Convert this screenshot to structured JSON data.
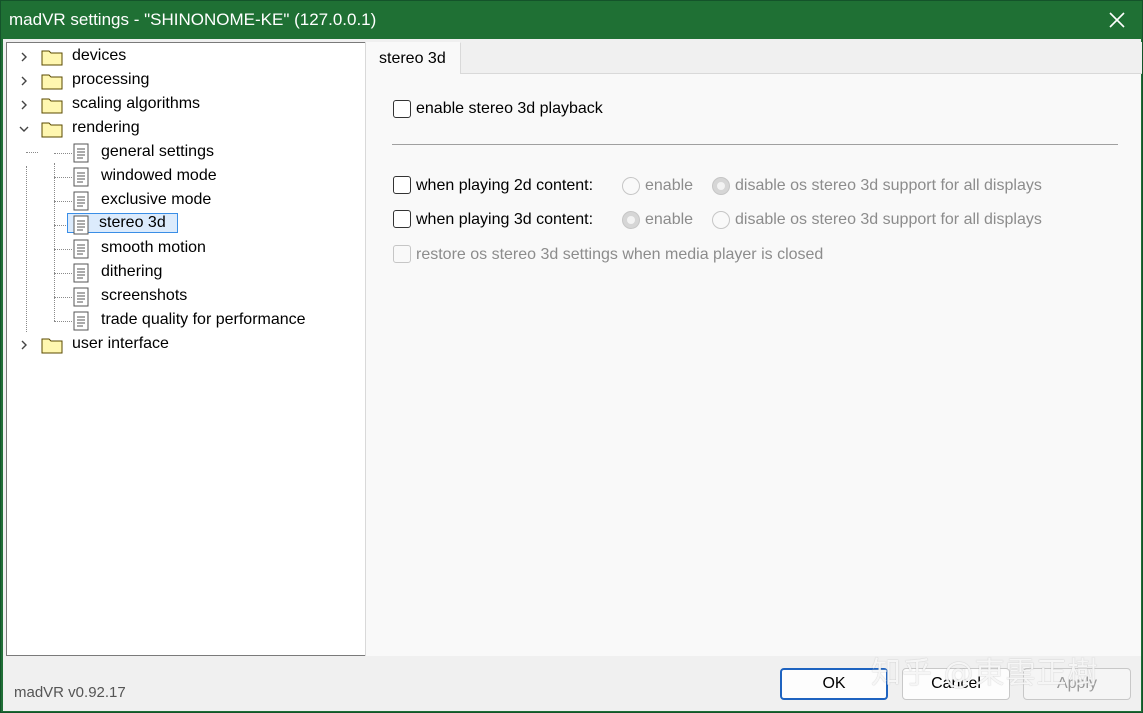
{
  "window": {
    "title": "madVR settings - \"SHINONOME-KE\" (127.0.0.1)"
  },
  "tree": {
    "devices": "devices",
    "processing": "processing",
    "scaling": "scaling algorithms",
    "rendering": "rendering",
    "children": [
      "general settings",
      "windowed mode",
      "exclusive mode",
      "stereo 3d",
      "smooth motion",
      "dithering",
      "screenshots",
      "trade quality for performance"
    ],
    "user_interface": "user interface",
    "selected": "stereo 3d"
  },
  "panel": {
    "tab": "stereo 3d",
    "enable_stereo": "enable stereo 3d playback",
    "when_2d": "when playing 2d content:",
    "when_3d": "when playing 3d content:",
    "radio_enable": "enable",
    "radio_disable": "disable os stereo 3d support for all displays",
    "restore": "restore os stereo 3d settings when media player is closed"
  },
  "footer": {
    "version": "madVR v0.92.17",
    "ok": "OK",
    "cancel": "Cancel",
    "apply": "Apply"
  },
  "watermark": "知乎 @東雲正樹",
  "colors": {
    "titlebar": "#1f7034",
    "selection_border": "#3a8ee6",
    "default_button": "#1e63c0"
  }
}
